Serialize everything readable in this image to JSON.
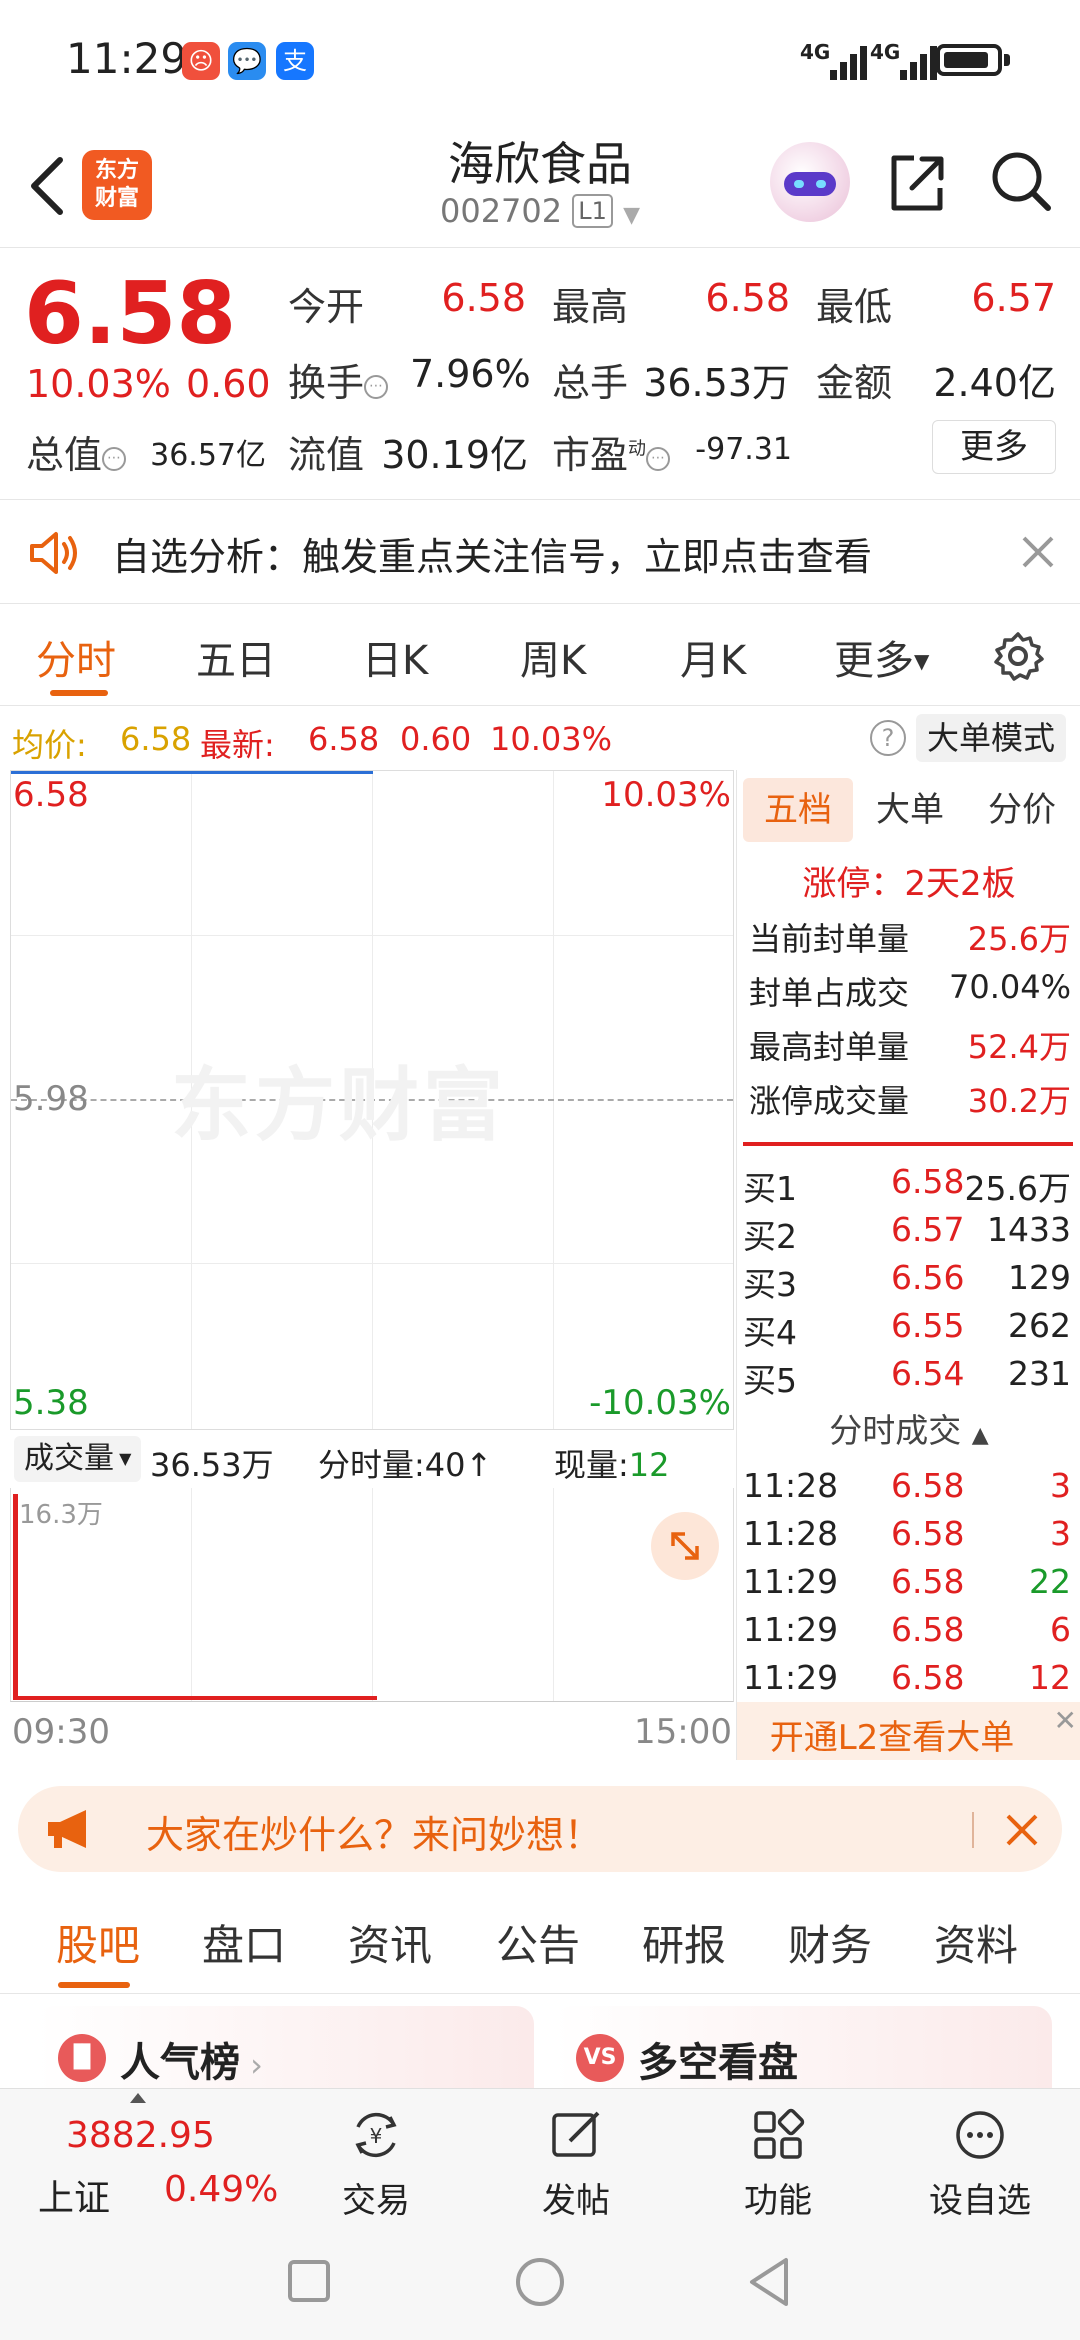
{
  "status": {
    "time": "11:29",
    "network": "4G 4G"
  },
  "header": {
    "name": "海欣食品",
    "code": "002702",
    "level": "L1",
    "logo": "东方\n财富"
  },
  "quote": {
    "price": "6.58",
    "pct": "10.03%",
    "change": "0.60",
    "open_label": "今开",
    "open": "6.58",
    "high_label": "最高",
    "high": "6.58",
    "low_label": "最低",
    "low": "6.57",
    "turnover_label": "换手",
    "turnover": "7.96%",
    "volume_label": "总手",
    "volume": "36.53万",
    "amount_label": "金额",
    "amount": "2.40亿",
    "mcap_label": "总值",
    "mcap": "36.57亿",
    "float_label": "流值",
    "float": "30.19亿",
    "pe_label": "市盈",
    "pe_sup": "动",
    "pe": "-97.31",
    "more": "更多"
  },
  "notice": {
    "text": "自选分析：触发重点关注信号，立即点击查看"
  },
  "chart_tabs": [
    "分时",
    "五日",
    "日K",
    "周K",
    "月K",
    "更多"
  ],
  "summary": {
    "avg_label": "均价:",
    "avg": "6.58",
    "last_label": "最新:",
    "last": "6.58",
    "chg": "0.60",
    "pct": "10.03%",
    "big_order_mode": "大单模式"
  },
  "chart": {
    "y_top": "6.58",
    "y_mid": "5.98",
    "y_bottom": "5.38",
    "pct_top": "10.03%",
    "pct_bottom": "-10.03%",
    "watermark": "东方财富"
  },
  "volume": {
    "selector": "成交量",
    "total": "36.53万",
    "period_label": "分时量:",
    "period": "40",
    "now_label": "现量:",
    "now": "12",
    "max": "16.3万"
  },
  "time_axis": {
    "start": "09:30",
    "end": "15:00"
  },
  "panel": {
    "tabs": [
      "五档",
      "大单",
      "分价"
    ],
    "limit_title": "涨停：2天2板",
    "seal": [
      {
        "k": "当前封单量",
        "v": "25.6万"
      },
      {
        "k": "封单占成交",
        "v": "70.04%"
      },
      {
        "k": "最高封单量",
        "v": "52.4万"
      },
      {
        "k": "涨停成交量",
        "v": "30.2万"
      }
    ],
    "bids": [
      {
        "k": "买1",
        "p": "6.58",
        "q": "25.6万"
      },
      {
        "k": "买2",
        "p": "6.57",
        "q": "1433"
      },
      {
        "k": "买3",
        "p": "6.56",
        "q": "129"
      },
      {
        "k": "买4",
        "p": "6.55",
        "q": "262"
      },
      {
        "k": "买5",
        "p": "6.54",
        "q": "231"
      }
    ],
    "ticks_title": "分时成交",
    "ticks": [
      {
        "t": "11:28",
        "p": "6.58",
        "q": "3"
      },
      {
        "t": "11:28",
        "p": "6.58",
        "q": "3"
      },
      {
        "t": "11:29",
        "p": "6.58",
        "q": "22"
      },
      {
        "t": "11:29",
        "p": "6.58",
        "q": "6"
      },
      {
        "t": "11:29",
        "p": "6.58",
        "q": "12"
      }
    ],
    "l2": "开通L2查看大单"
  },
  "ask": {
    "text": "大家在炒什么？来问妙想！"
  },
  "bottom_tabs": [
    "股吧",
    "盘口",
    "资讯",
    "公告",
    "研报",
    "财务",
    "资料"
  ],
  "cards": {
    "popular": "人气榜",
    "bull_bear": "多空看盘",
    "vs": "VS"
  },
  "index": {
    "value": "3882.95",
    "name": "上证",
    "pct": "0.49%"
  },
  "nav": {
    "trade": "交易",
    "post": "发帖",
    "func": "功能",
    "watch": "设自选"
  },
  "colors": {
    "up": "#e02020",
    "down": "#1a9a2a",
    "accent": "#e8620f"
  }
}
